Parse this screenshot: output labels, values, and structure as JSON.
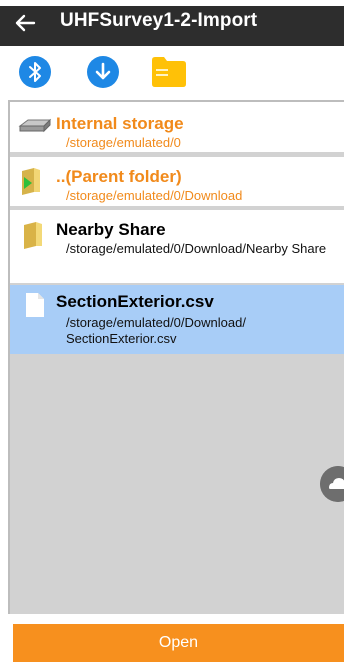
{
  "header": {
    "title": "UHFSurvey1-2-Import",
    "back_icon": "arrow-left-icon"
  },
  "toolbar": {
    "buttons": [
      {
        "icon": "bluetooth-icon",
        "color": "#1e88e5"
      },
      {
        "icon": "download-icon",
        "color": "#1e88e5"
      },
      {
        "icon": "folder-icon",
        "color": "#ffc107"
      }
    ]
  },
  "files": [
    {
      "name": "Internal storage",
      "path": "/storage/emulated/0",
      "icon": "drive-icon",
      "style": "orange"
    },
    {
      "name": "..(Parent folder)",
      "path": "/storage/emulated/0/Download",
      "icon": "parent-folder-icon",
      "style": "orange"
    },
    {
      "name": "Nearby Share",
      "path": "/storage/emulated/0/Download/Nearby Share",
      "icon": "folder-icon",
      "style": "dark"
    },
    {
      "name": "SectionExterior.csv",
      "path": "/storage/emulated/0/Download/ SectionExterior.csv",
      "icon": "file-icon",
      "style": "dark",
      "selected": true
    }
  ],
  "footer": {
    "open_label": "Open"
  },
  "colors": {
    "accent": "#f7901e",
    "appbar": "#2d2d2d",
    "selected_row": "#a8cdf7",
    "orange_text": "#f18a1b"
  }
}
